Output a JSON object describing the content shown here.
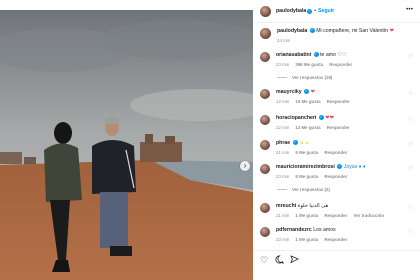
{
  "post": {
    "username": "paulodybala",
    "follow_label": "Seguir",
    "caption": "Mi compañere, mi San Valentín",
    "caption_time": "24 min",
    "more_icon": "more-horizontal-icon",
    "next_icon": "chevron-right-icon"
  },
  "comments": [
    {
      "user": "orianasabatini",
      "verified": true,
      "text": "te amo ♡♡",
      "time": "23 min",
      "likes": "396 Me gusta",
      "reply": "Responder",
      "replies": "Ver respuestas (18)"
    },
    {
      "user": "mauyrciky",
      "verified": true,
      "text": "❤",
      "time": "12 min",
      "likes": "15 Me gusta",
      "reply": "Responder"
    },
    {
      "user": "horaciopancheri",
      "verified": true,
      "text": "❤❤",
      "time": "12 min",
      "likes": "13 Me gusta",
      "reply": "Responder"
    },
    {
      "user": "phrae",
      "verified": true,
      "text": "☺☺",
      "time": "21 min",
      "likes": "9 Me gusta",
      "reply": "Responder"
    },
    {
      "user": "mauricioramirezimbrosi",
      "verified": true,
      "text": "Joyas ♦ ♦",
      "time": "23 min",
      "likes": "8 Me gusta",
      "reply": "Responder",
      "replies": "Ver respuestas (2)"
    },
    {
      "user": "mreuchi",
      "verified": false,
      "text": "هى الدنيا حلوة",
      "time": "21 min",
      "likes": "1 Me gusta",
      "reply": "Responder",
      "translate": "Ver traducción"
    },
    {
      "user": "pdfernandezrc",
      "verified": false,
      "text": "Los amos",
      "time": "23 min",
      "likes": "1 Me gusta",
      "reply": "Responder"
    }
  ],
  "actions": {
    "like_icon": "heart-outline-icon",
    "comment_icon": "comment-icon",
    "share_icon": "share-icon"
  },
  "colors": {
    "verified_blue": "#0095f6",
    "heart_red": "#ed4956"
  }
}
